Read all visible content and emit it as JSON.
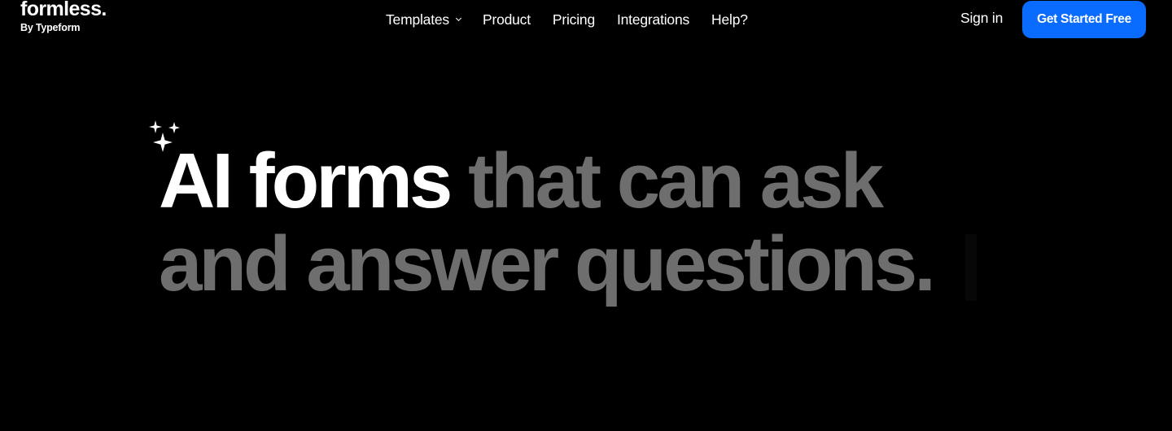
{
  "brand": {
    "name": "formless.",
    "tagline": "By Typeform"
  },
  "nav": {
    "items": [
      {
        "label": "Templates",
        "has_dropdown": true
      },
      {
        "label": "Product",
        "has_dropdown": false
      },
      {
        "label": "Pricing",
        "has_dropdown": false
      },
      {
        "label": "Integrations",
        "has_dropdown": false
      },
      {
        "label": "Help?",
        "has_dropdown": false
      }
    ]
  },
  "auth": {
    "signin_label": "Sign in",
    "cta_label": "Get Started Free"
  },
  "hero": {
    "highlight": "AI forms",
    "rest_line1": " that can ask",
    "line2": "and answer questions."
  },
  "icons": {
    "sparkles": "sparkles-icon",
    "dropdown": "chevron-down-icon"
  },
  "colors": {
    "background": "#000000",
    "text": "#ffffff",
    "muted_text": "#6e6e6e",
    "accent": "#0a6bff"
  }
}
